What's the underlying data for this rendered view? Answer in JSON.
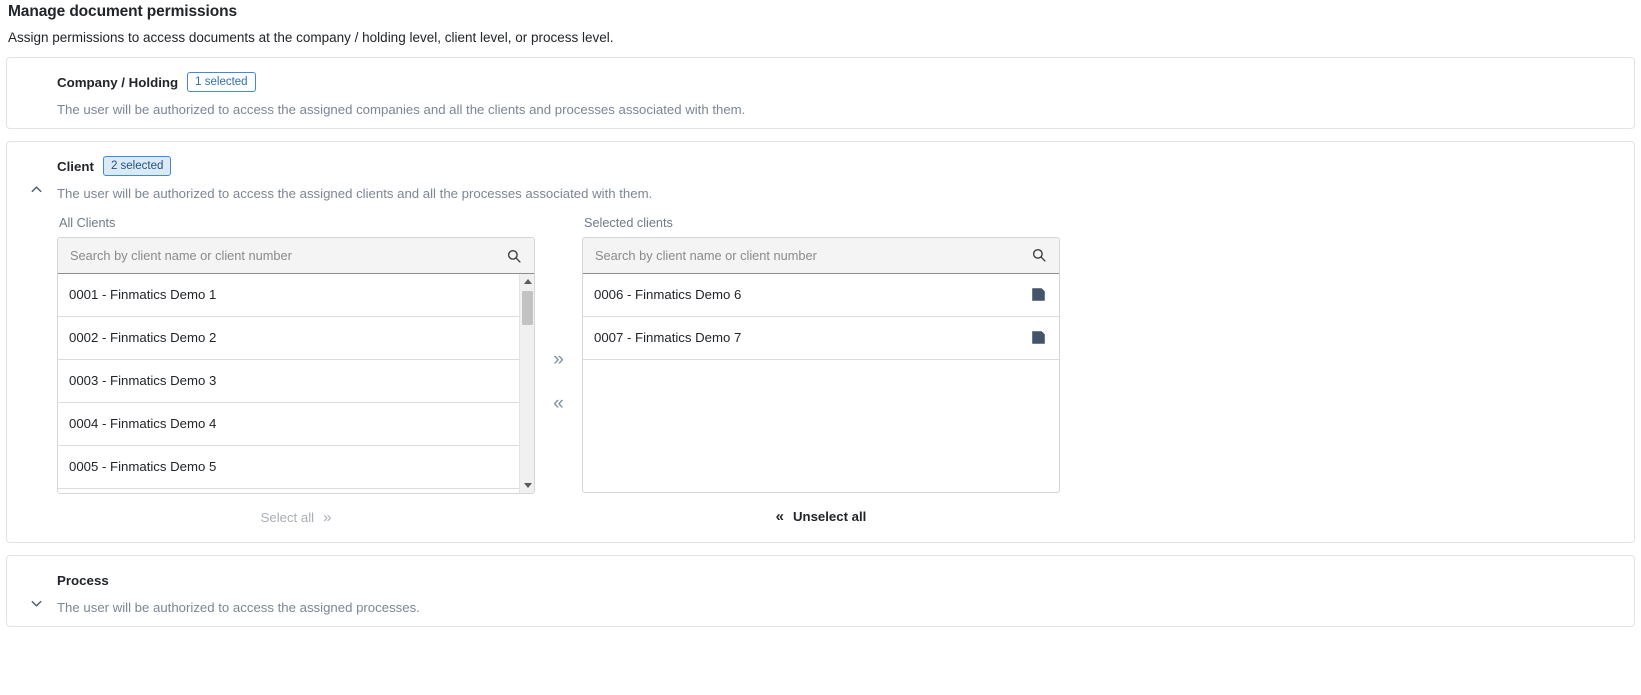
{
  "header": {
    "title": "Manage document permissions",
    "subtitle": "Assign permissions to access documents at the company / holding level, client level, or process level."
  },
  "sections": {
    "company": {
      "heading": "Company / Holding",
      "badge": "1 selected",
      "description": "The user will be authorized to access the assigned companies and all the clients and processes associated with them.",
      "chevron": "chevron-down",
      "expanded": false
    },
    "client": {
      "heading": "Client",
      "badge": "2 selected",
      "description": "The user will be authorized to access the assigned clients and all the processes associated with them.",
      "chevron": "chevron-up",
      "expanded": true,
      "available": {
        "label": "All Clients",
        "search_placeholder": "Search by client name or client number",
        "search_value": "",
        "items": [
          "0001 - Finmatics Demo 1",
          "0002 - Finmatics Demo 2",
          "0003 - Finmatics Demo 3",
          "0004 - Finmatics Demo 4",
          "0005 - Finmatics Demo 5"
        ],
        "footer_label": "Select all",
        "footer_chevron": "»"
      },
      "selected": {
        "label": "Selected clients",
        "search_placeholder": "Search by client name or client number",
        "search_value": "",
        "items": [
          "0006 - Finmatics Demo 6",
          "0007 - Finmatics Demo 7"
        ],
        "footer_label": "Unselect all",
        "footer_chevron": "«"
      },
      "transfer": {
        "move_right": "»",
        "move_left": "«"
      }
    },
    "process": {
      "heading": "Process",
      "badge": "",
      "description": "The user will be authorized to access the assigned processes.",
      "chevron": "chevron-down",
      "expanded": false
    }
  },
  "colors": {
    "accent": "#3f8ae0",
    "badge_fill": "#dceaf8",
    "muted_text": "#7c8694",
    "panel_border": "#e3e3e3"
  }
}
